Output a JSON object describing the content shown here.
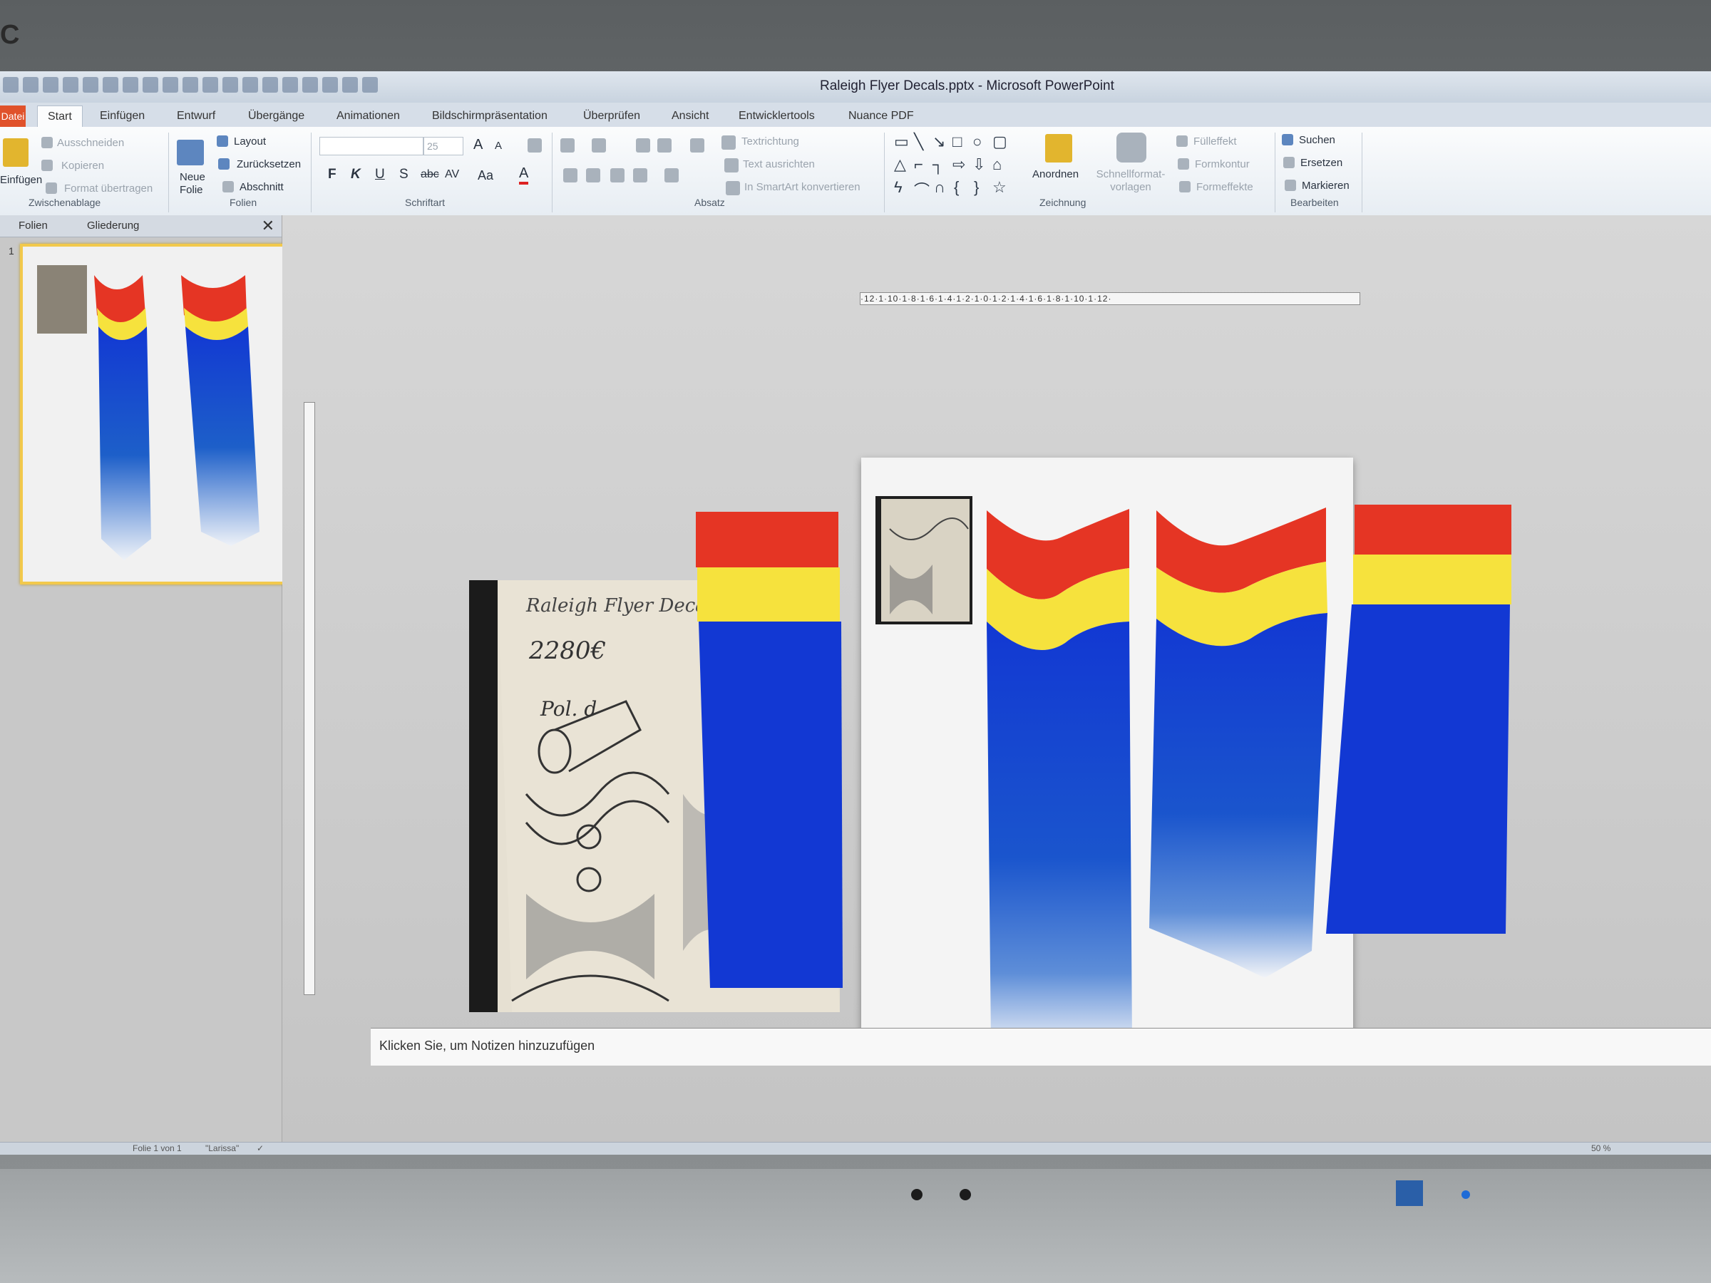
{
  "window": {
    "title": "Raleigh Flyer Decals.pptx - Microsoft PowerPoint"
  },
  "tabs": [
    {
      "label": "Datei"
    },
    {
      "label": "Start"
    },
    {
      "label": "Einfügen"
    },
    {
      "label": "Entwurf"
    },
    {
      "label": "Übergänge"
    },
    {
      "label": "Animationen"
    },
    {
      "label": "Bildschirmpräsentation"
    },
    {
      "label": "Überprüfen"
    },
    {
      "label": "Ansicht"
    },
    {
      "label": "Entwicklertools"
    },
    {
      "label": "Nuance PDF"
    }
  ],
  "ribbon": {
    "clipboard": {
      "paste": "Einfügen",
      "cut": "Ausschneiden",
      "copy": "Kopieren",
      "format_painter": "Format übertragen",
      "label": "Zwischenablage"
    },
    "slides": {
      "new_slide": "Neue Folie",
      "layout": "Layout",
      "reset": "Zurücksetzen",
      "section": "Abschnitt",
      "label": "Folien"
    },
    "font": {
      "size": "25",
      "bold": "F",
      "italic": "K",
      "underline": "U",
      "strike": "S",
      "strike2": "abc",
      "spacing": "AV",
      "case": "Aa",
      "color": "A",
      "label": "Schriftart"
    },
    "paragraph": {
      "text_direction": "Textrichtung",
      "align_text": "Text ausrichten",
      "smartart": "In SmartArt konvertieren",
      "label": "Absatz"
    },
    "drawing": {
      "arrange": "Anordnen",
      "quick_styles": "Schnellformat-vorlagen",
      "fill": "Fülleffekt",
      "outline": "Formkontur",
      "effects": "Formeffekte",
      "label": "Zeichnung"
    },
    "editing": {
      "find": "Suchen",
      "replace": "Ersetzen",
      "select": "Markieren",
      "label": "Bearbeiten"
    }
  },
  "slide_pane": {
    "tab_slides": "Folien",
    "tab_outline": "Gliederung",
    "close": "✕",
    "slide_number": "1"
  },
  "ruler": {
    "text": "·12·1·10·1·8·1·6·1·4·1·2·1·0·1·2·1·4·1·6·1·8·1·10·1·12·"
  },
  "sketch": {
    "heading": "Raleigh Flyer Decals",
    "number": "2280€",
    "note": "Pol. d"
  },
  "notes": {
    "placeholder": "Klicken Sie, um Notizen hinzuzufügen"
  },
  "status": {
    "slide": "Folie 1 von 1",
    "theme": "\"Larissa\"",
    "zoom": "50 %"
  },
  "colors": {
    "red": "#e53524",
    "yellow": "#f6e23d",
    "blue": "#1238d3",
    "file_tab": "#e0522b"
  }
}
